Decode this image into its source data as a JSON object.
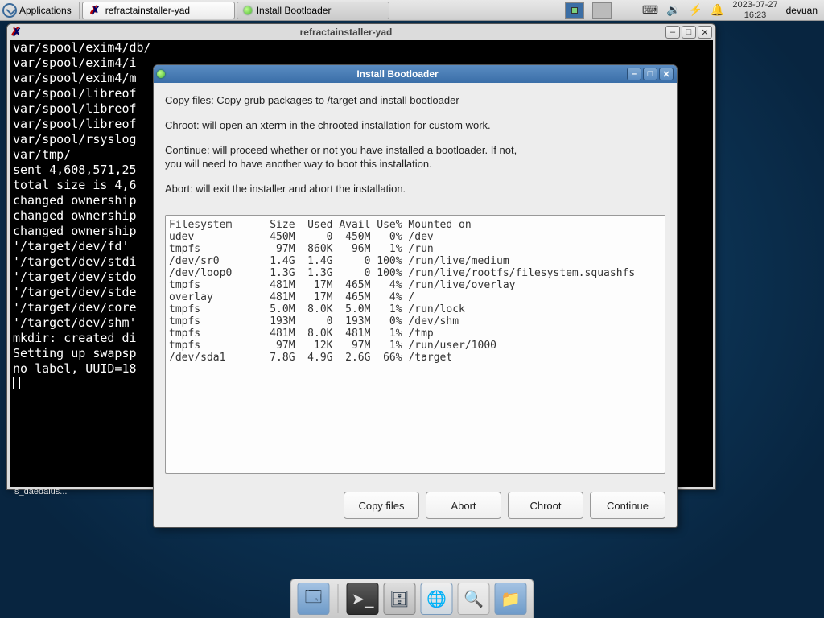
{
  "panel": {
    "apps_label": "Applications",
    "task1": "refractainstaller-yad",
    "task2": "Install Bootloader",
    "user": "devuan",
    "date": "2023-07-27",
    "time": "16:23"
  },
  "term": {
    "title": "refractainstaller-yad",
    "lines": [
      "var/spool/exim4/db/",
      "var/spool/exim4/i",
      "var/spool/exim4/m",
      "var/spool/libreof",
      "var/spool/libreof",
      "var/spool/libreof",
      "var/spool/rsyslog",
      "var/tmp/",
      "",
      "sent 4,608,571,25",
      "total size is 4,6",
      "changed ownership",
      "changed ownership",
      "changed ownership",
      "'/target/dev/fd' ",
      "'/target/dev/stdi",
      "'/target/dev/stdo",
      "'/target/dev/stde",
      "'/target/dev/core",
      "'/target/dev/shm'",
      "mkdir: created di",
      "Setting up swapsp",
      "no label, UUID=18"
    ]
  },
  "dialog": {
    "title": "Install Bootloader",
    "p1": "Copy files: Copy grub packages to /target and install bootloader",
    "p2": "Chroot: will open an xterm in the chrooted installation for custom work.",
    "p3a": "Continue: will proceed whether or not you have installed a bootloader. If not,",
    "p3b": "you will need to have another way to boot this installation.",
    "p4": "Abort: will exit the installer and abort the installation.",
    "df": "Filesystem      Size  Used Avail Use% Mounted on\nudev            450M     0  450M   0% /dev\ntmpfs            97M  860K   96M   1% /run\n/dev/sr0        1.4G  1.4G     0 100% /run/live/medium\n/dev/loop0      1.3G  1.3G     0 100% /run/live/rootfs/filesystem.squashfs\ntmpfs           481M   17M  465M   4% /run/live/overlay\noverlay         481M   17M  465M   4% /\ntmpfs           5.0M  8.0K  5.0M   1% /run/lock\ntmpfs           193M     0  193M   0% /dev/shm\ntmpfs           481M  8.0K  481M   1% /tmp\ntmpfs            97M   12K   97M   1% /run/user/1000\n/dev/sda1       7.8G  4.9G  2.6G  66% /target",
    "btn_copy": "Copy files",
    "btn_abort": "Abort",
    "btn_chroot": "Chroot",
    "btn_continue": "Continue"
  },
  "residual": "s_daedalus..."
}
